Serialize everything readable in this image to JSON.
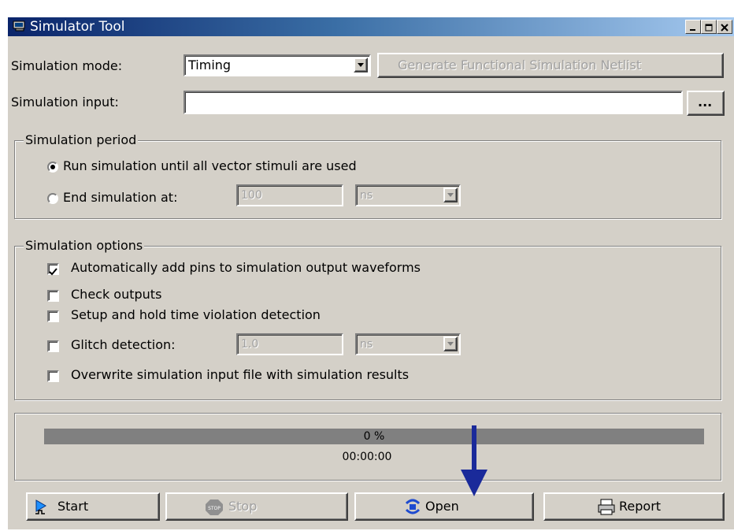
{
  "window": {
    "title": "Simulator Tool"
  },
  "mode": {
    "label": "Simulation mode:",
    "value": "Timing",
    "netlist_button": "Generate Functional Simulation Netlist"
  },
  "input": {
    "label": "Simulation input:",
    "value": "",
    "browse": "..."
  },
  "period": {
    "title": "Simulation period",
    "run_label": "Run simulation until all vector stimuli are used",
    "end_label": "End simulation at:",
    "end_value": "100",
    "end_unit": "ns"
  },
  "options": {
    "title": "Simulation options",
    "auto_pins": "Automatically add pins to simulation output waveforms",
    "check_outputs": "Check outputs",
    "setup_hold": "Setup and hold time violation detection",
    "glitch": "Glitch detection:",
    "glitch_value": "1.0",
    "glitch_unit": "ns",
    "overwrite": "Overwrite simulation input file with simulation results"
  },
  "progress": {
    "percent_text": "0 %",
    "percent": 0,
    "time": "00:00:00"
  },
  "buttons": {
    "start": "Start",
    "stop": "Stop",
    "open": "Open",
    "report": "Report"
  },
  "colors": {
    "face": "#d4d0c8",
    "title_start": "#0a246a",
    "title_end": "#a6caf0",
    "progress": "#808080",
    "arrow": "#1a2a9a"
  }
}
